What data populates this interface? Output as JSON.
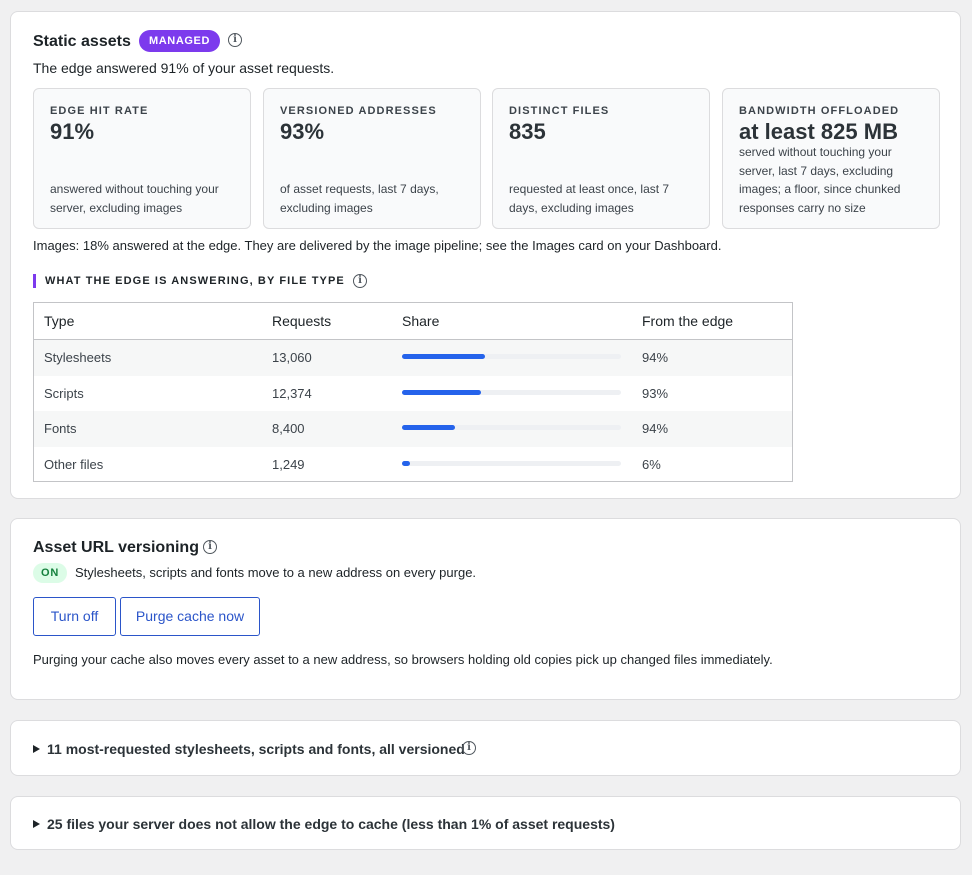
{
  "static_assets": {
    "title": "Static assets",
    "badge": "MANAGED",
    "summary": "The edge answered 91% of your asset requests.",
    "tiles": [
      {
        "label": "EDGE HIT RATE",
        "value": "91%",
        "description": "answered without touching your server, excluding images"
      },
      {
        "label": "VERSIONED ADDRESSES",
        "value": "93%",
        "description": "of asset requests, last 7 days, excluding images"
      },
      {
        "label": "DISTINCT FILES",
        "value": "835",
        "description": "requested at least once, last 7 days, excluding images"
      },
      {
        "label": "BANDWIDTH OFFLOADED",
        "value": "at least 825 MB",
        "description": "served without touching your server, last 7 days, excluding images; a floor, since chunked responses carry no size"
      }
    ],
    "images_note": "Images: 18% answered at the edge. They are delivered by the image pipeline; see the Images card on your Dashboard.",
    "section_title": "WHAT THE EDGE IS ANSWERING, BY FILE TYPE",
    "table": {
      "headers": [
        "Type",
        "Requests",
        "Share",
        "From the edge"
      ],
      "rows": [
        {
          "type": "Stylesheets",
          "requests": "13,060",
          "share": 0.38,
          "edge": "94%"
        },
        {
          "type": "Scripts",
          "requests": "12,374",
          "share": 0.36,
          "edge": "93%"
        },
        {
          "type": "Fonts",
          "requests": "8,400",
          "share": 0.24,
          "edge": "94%"
        },
        {
          "type": "Other files",
          "requests": "1,249",
          "share": 0.035,
          "edge": "6%"
        }
      ],
      "bar_color": "#2563eb"
    }
  },
  "versioning": {
    "title": "Asset URL versioning",
    "status": "ON",
    "status_text": "Stylesheets, scripts and fonts move to a new address on every purge.",
    "buttons": {
      "turn_off": "Turn off",
      "purge": "Purge cache now"
    },
    "note": "Purging your cache also moves every asset to a new address, so browsers holding old copies pick up changed files immediately."
  },
  "disclosures": {
    "top_assets": "11 most-requested stylesheets, scripts and fonts, all versioned",
    "uncacheable": "25 files your server does not allow the edge to cache (less than 1% of asset requests)"
  },
  "colors": {
    "accent": "#7c3aed",
    "link": "#2b55c9",
    "on_badge": "#15803d"
  },
  "icons": [
    "info-icon",
    "triangle-right-icon"
  ]
}
